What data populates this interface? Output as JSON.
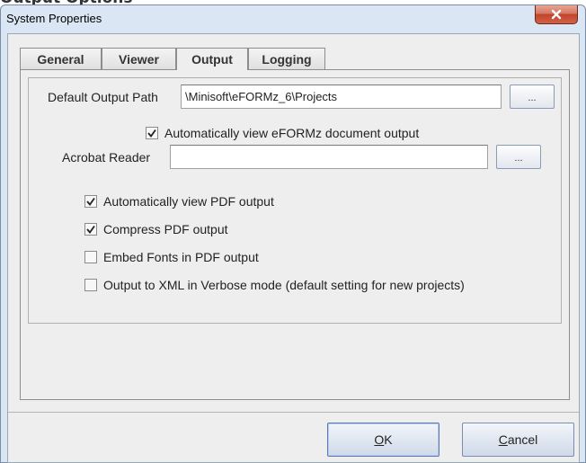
{
  "page_heading": "Output Options",
  "window": {
    "title": "System Properties"
  },
  "tabs": [
    {
      "label": "General",
      "active": false
    },
    {
      "label": "Viewer",
      "active": false
    },
    {
      "label": "Output",
      "active": true
    },
    {
      "label": "Logging",
      "active": false
    }
  ],
  "output": {
    "default_output_path_label": "Default Output Path",
    "default_output_path_value": "\\Minisoft\\eFORMz_6\\Projects",
    "browse_label": "...",
    "auto_view_eformz_label": "Automatically view eFORMz document output",
    "auto_view_eformz_checked": true,
    "acrobat_reader_label": "Acrobat Reader",
    "acrobat_reader_value": "",
    "checkboxes": [
      {
        "label": "Automatically view PDF output",
        "checked": true
      },
      {
        "label": "Compress PDF output",
        "checked": true
      },
      {
        "label": "Embed Fonts in PDF output",
        "checked": false
      },
      {
        "label": "Output to XML in Verbose mode (default setting for new projects)",
        "checked": false
      }
    ]
  },
  "buttons": {
    "ok_mnemonic": "O",
    "ok_rest": "K",
    "cancel_mnemonic": "C",
    "cancel_rest": "ancel"
  },
  "colors": {
    "titlebar": "#dae6f3",
    "close": "#c2442a",
    "panel": "#eeeeee"
  }
}
